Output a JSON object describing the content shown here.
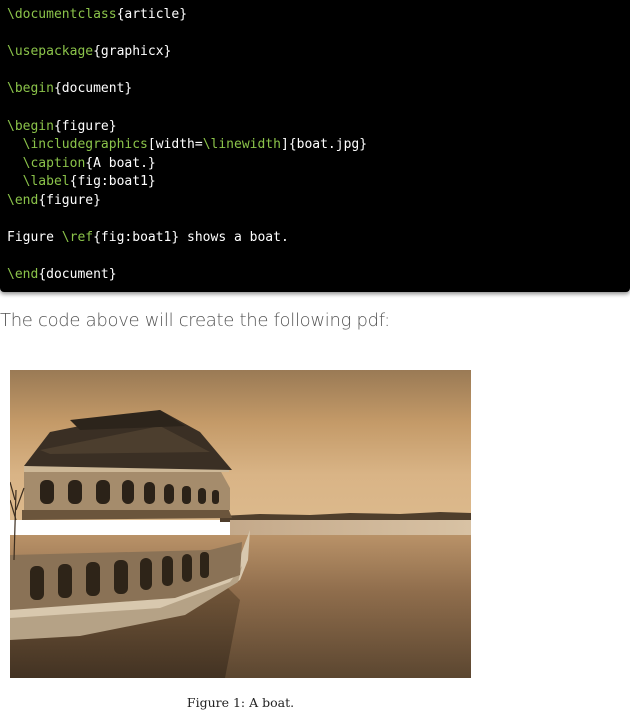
{
  "code": {
    "lines": [
      [
        {
          "t": "\\documentclass",
          "k": true
        },
        {
          "t": "{article}",
          "k": false
        }
      ],
      [],
      [
        {
          "t": "\\usepackage",
          "k": true
        },
        {
          "t": "{graphicx}",
          "k": false
        }
      ],
      [],
      [
        {
          "t": "\\begin",
          "k": true
        },
        {
          "t": "{document}",
          "k": false
        }
      ],
      [],
      [
        {
          "t": "\\begin",
          "k": true
        },
        {
          "t": "{figure}",
          "k": false
        }
      ],
      [
        {
          "t": "  ",
          "k": false
        },
        {
          "t": "\\includegraphics",
          "k": true
        },
        {
          "t": "[width=",
          "k": false
        },
        {
          "t": "\\linewidth",
          "k": true
        },
        {
          "t": "]{boat.jpg}",
          "k": false
        }
      ],
      [
        {
          "t": "  ",
          "k": false
        },
        {
          "t": "\\caption",
          "k": true
        },
        {
          "t": "{A boat.}",
          "k": false
        }
      ],
      [
        {
          "t": "  ",
          "k": false
        },
        {
          "t": "\\label",
          "k": true
        },
        {
          "t": "{fig:boat1}",
          "k": false
        }
      ],
      [
        {
          "t": "\\end",
          "k": true
        },
        {
          "t": "{figure}",
          "k": false
        }
      ],
      [],
      [
        {
          "t": "Figure ",
          "k": false
        },
        {
          "t": "\\ref",
          "k": true
        },
        {
          "t": "{fig:boat1} shows a boat.",
          "k": false
        }
      ],
      [],
      [
        {
          "t": "\\end",
          "k": true
        },
        {
          "t": "{document}",
          "k": false
        }
      ]
    ]
  },
  "intro_text": "The code above will create the following pdf:",
  "figure": {
    "caption": "Figure 1:  A boat."
  },
  "colors": {
    "code_background": "#000000",
    "code_keyword": "#8bc34a",
    "code_text": "#ffffff",
    "intro_text": "#555555"
  }
}
